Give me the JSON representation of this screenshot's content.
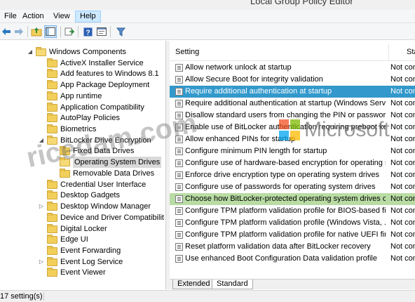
{
  "window": {
    "title": "Local Group Policy Editor"
  },
  "menu": {
    "items": [
      "File",
      "Action",
      "View",
      "Help"
    ],
    "active_index": 3
  },
  "toolbar": {
    "icons": [
      "back-arrow-icon",
      "forward-arrow-icon",
      "up-folder-icon",
      "show-hide-tree-icon",
      "export-list-icon",
      "help-icon",
      "properties-icon",
      "filter-icon"
    ]
  },
  "tree": {
    "items": [
      {
        "label": "Windows Components",
        "indent": 0,
        "expander": "◢",
        "open": true
      },
      {
        "label": "ActiveX Installer Service",
        "indent": 1,
        "expander": ""
      },
      {
        "label": "Add features to Windows 8.1",
        "indent": 1,
        "expander": ""
      },
      {
        "label": "App Package Deployment",
        "indent": 1,
        "expander": ""
      },
      {
        "label": "App runtime",
        "indent": 1,
        "expander": ""
      },
      {
        "label": "Application Compatibility",
        "indent": 1,
        "expander": ""
      },
      {
        "label": "AutoPlay Policies",
        "indent": 1,
        "expander": ""
      },
      {
        "label": "Biometrics",
        "indent": 1,
        "expander": ""
      },
      {
        "label": "BitLocker Drive Encryption",
        "indent": 1,
        "expander": "◢",
        "open": true
      },
      {
        "label": "Fixed Data Drives",
        "indent": 2,
        "expander": ""
      },
      {
        "label": "Operating System Drives",
        "indent": 2,
        "expander": "",
        "selected": true,
        "open": true
      },
      {
        "label": "Removable Data Drives",
        "indent": 2,
        "expander": ""
      },
      {
        "label": "Credential User Interface",
        "indent": 1,
        "expander": ""
      },
      {
        "label": "Desktop Gadgets",
        "indent": 1,
        "expander": ""
      },
      {
        "label": "Desktop Window Manager",
        "indent": 1,
        "expander": "▷"
      },
      {
        "label": "Device and Driver Compatibilit",
        "indent": 1,
        "expander": ""
      },
      {
        "label": "Digital Locker",
        "indent": 1,
        "expander": ""
      },
      {
        "label": "Edge UI",
        "indent": 1,
        "expander": ""
      },
      {
        "label": "Event Forwarding",
        "indent": 1,
        "expander": ""
      },
      {
        "label": "Event Log Service",
        "indent": 1,
        "expander": "▷"
      },
      {
        "label": "Event Viewer",
        "indent": 1,
        "expander": ""
      }
    ]
  },
  "list": {
    "columns": {
      "setting": "Setting",
      "state": "Sta"
    },
    "rows": [
      {
        "setting": "Allow network unlock at startup",
        "state": "Not con"
      },
      {
        "setting": "Allow Secure Boot for integrity validation",
        "state": "Not con"
      },
      {
        "setting": "Require additional authentication at startup",
        "state": "Not con",
        "selected": true
      },
      {
        "setting": "Require additional authentication at startup (Windows Serve...",
        "state": "Not con"
      },
      {
        "setting": "Disallow standard users from changing the PIN or password",
        "state": "Not con"
      },
      {
        "setting": "Enable use of BitLocker authentication requiring preboot ke...",
        "state": "Not con"
      },
      {
        "setting": "Allow enhanced PINs for startup",
        "state": "Not con"
      },
      {
        "setting": "Configure minimum PIN length for startup",
        "state": "Not con"
      },
      {
        "setting": "Configure use of hardware-based encryption for operating s...",
        "state": "Not con"
      },
      {
        "setting": "Enforce drive encryption type on operating system drives",
        "state": "Not con"
      },
      {
        "setting": "Configure use of passwords for operating system drives",
        "state": "Not con"
      },
      {
        "setting": "Choose how BitLocker-protected operating system drives ca...",
        "state": "Not con",
        "highlight": true
      },
      {
        "setting": "Configure TPM platform validation profile for BIOS-based fi...",
        "state": "Not con"
      },
      {
        "setting": "Configure TPM platform validation profile (Windows Vista, ...",
        "state": "Not con"
      },
      {
        "setting": "Configure TPM platform validation profile for native UEFI fir...",
        "state": "Not con"
      },
      {
        "setting": "Reset platform validation data after BitLocker recovery",
        "state": "Not con"
      },
      {
        "setting": "Use enhanced Boot Configuration Data validation profile",
        "state": "Not con"
      }
    ]
  },
  "tabs": {
    "extended": "Extended",
    "standard": "Standard",
    "active": "Standard"
  },
  "status": {
    "text": "17 setting(s)"
  },
  "watermark": {
    "site": "ricedam.com",
    "brand": "Microsoft"
  },
  "colors": {
    "selection": "#3399cc",
    "highlight": "#b9dca4",
    "folder": "#f2cf5b"
  }
}
